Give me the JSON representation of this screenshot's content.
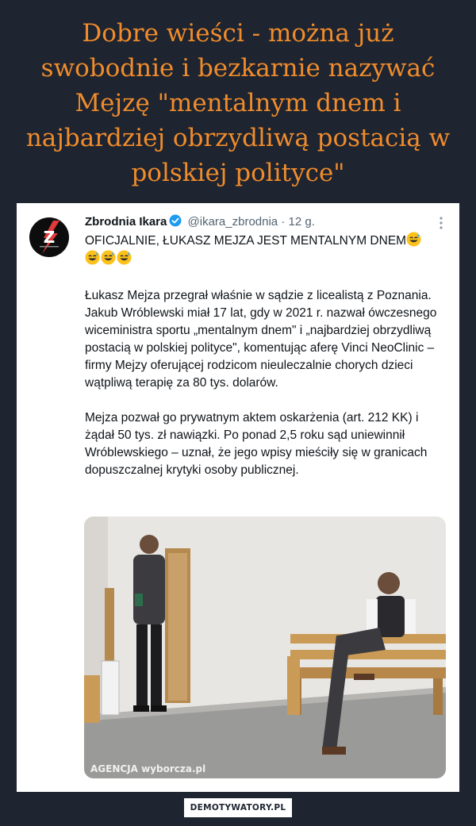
{
  "meme": {
    "title": "Dobre wieści - można już swobodnie i bezkarnie nazywać Mejzę \"mentalnym dnem i najbardziej obrzydliwą postacią w polskiej polityce\"",
    "watermark": "DEMOTYWATORY.PL"
  },
  "tweet": {
    "author_name": "Zbrodnia Ikara",
    "handle": "@ikara_zbrodnia",
    "time": "12 g.",
    "lead": "OFICJALNIE, ŁUKASZ MEJZA JEST MENTALNYM DNEM",
    "paragraphs": [
      "Łukasz Mejza przegrał właśnie w sądzie z licealistą z Poznania. Jakub Wróblewski miał 17 lat, gdy w 2021 r. nazwał ówczesnego wiceministra sportu „mentalnym dnem\" i „najbardziej obrzydliwą postacią w polskiej polityce\", komentując aferę Vinci NeoClinic – firmy Mejzy oferującej rodzicom nieuleczalnie chorych dzieci wątpliwą terapię za 80 tys. dolarów.",
      "Mejza pozwał go prywatnym aktem oskarżenia (art. 212 KK) i żądał 50 tys. zł nawiązki. Po ponad 2,5 roku sąd uniewinnił Wróblewskiego – uznał, że jego wpisy mieściły się w granicach dopuszczalnej krytyki osoby publicznej."
    ],
    "avatar_letter": "Z",
    "photo_credit": "AGENCJA wyborcza.pl",
    "icons": {
      "verified": "verified-badge-icon",
      "more": "more-dots-icon",
      "emoji": "sweat-smile-emoji-icon"
    }
  },
  "colors": {
    "background": "#1e2430",
    "title": "#f08c2c",
    "verified": "#1d9bf0",
    "handle": "#536471"
  }
}
